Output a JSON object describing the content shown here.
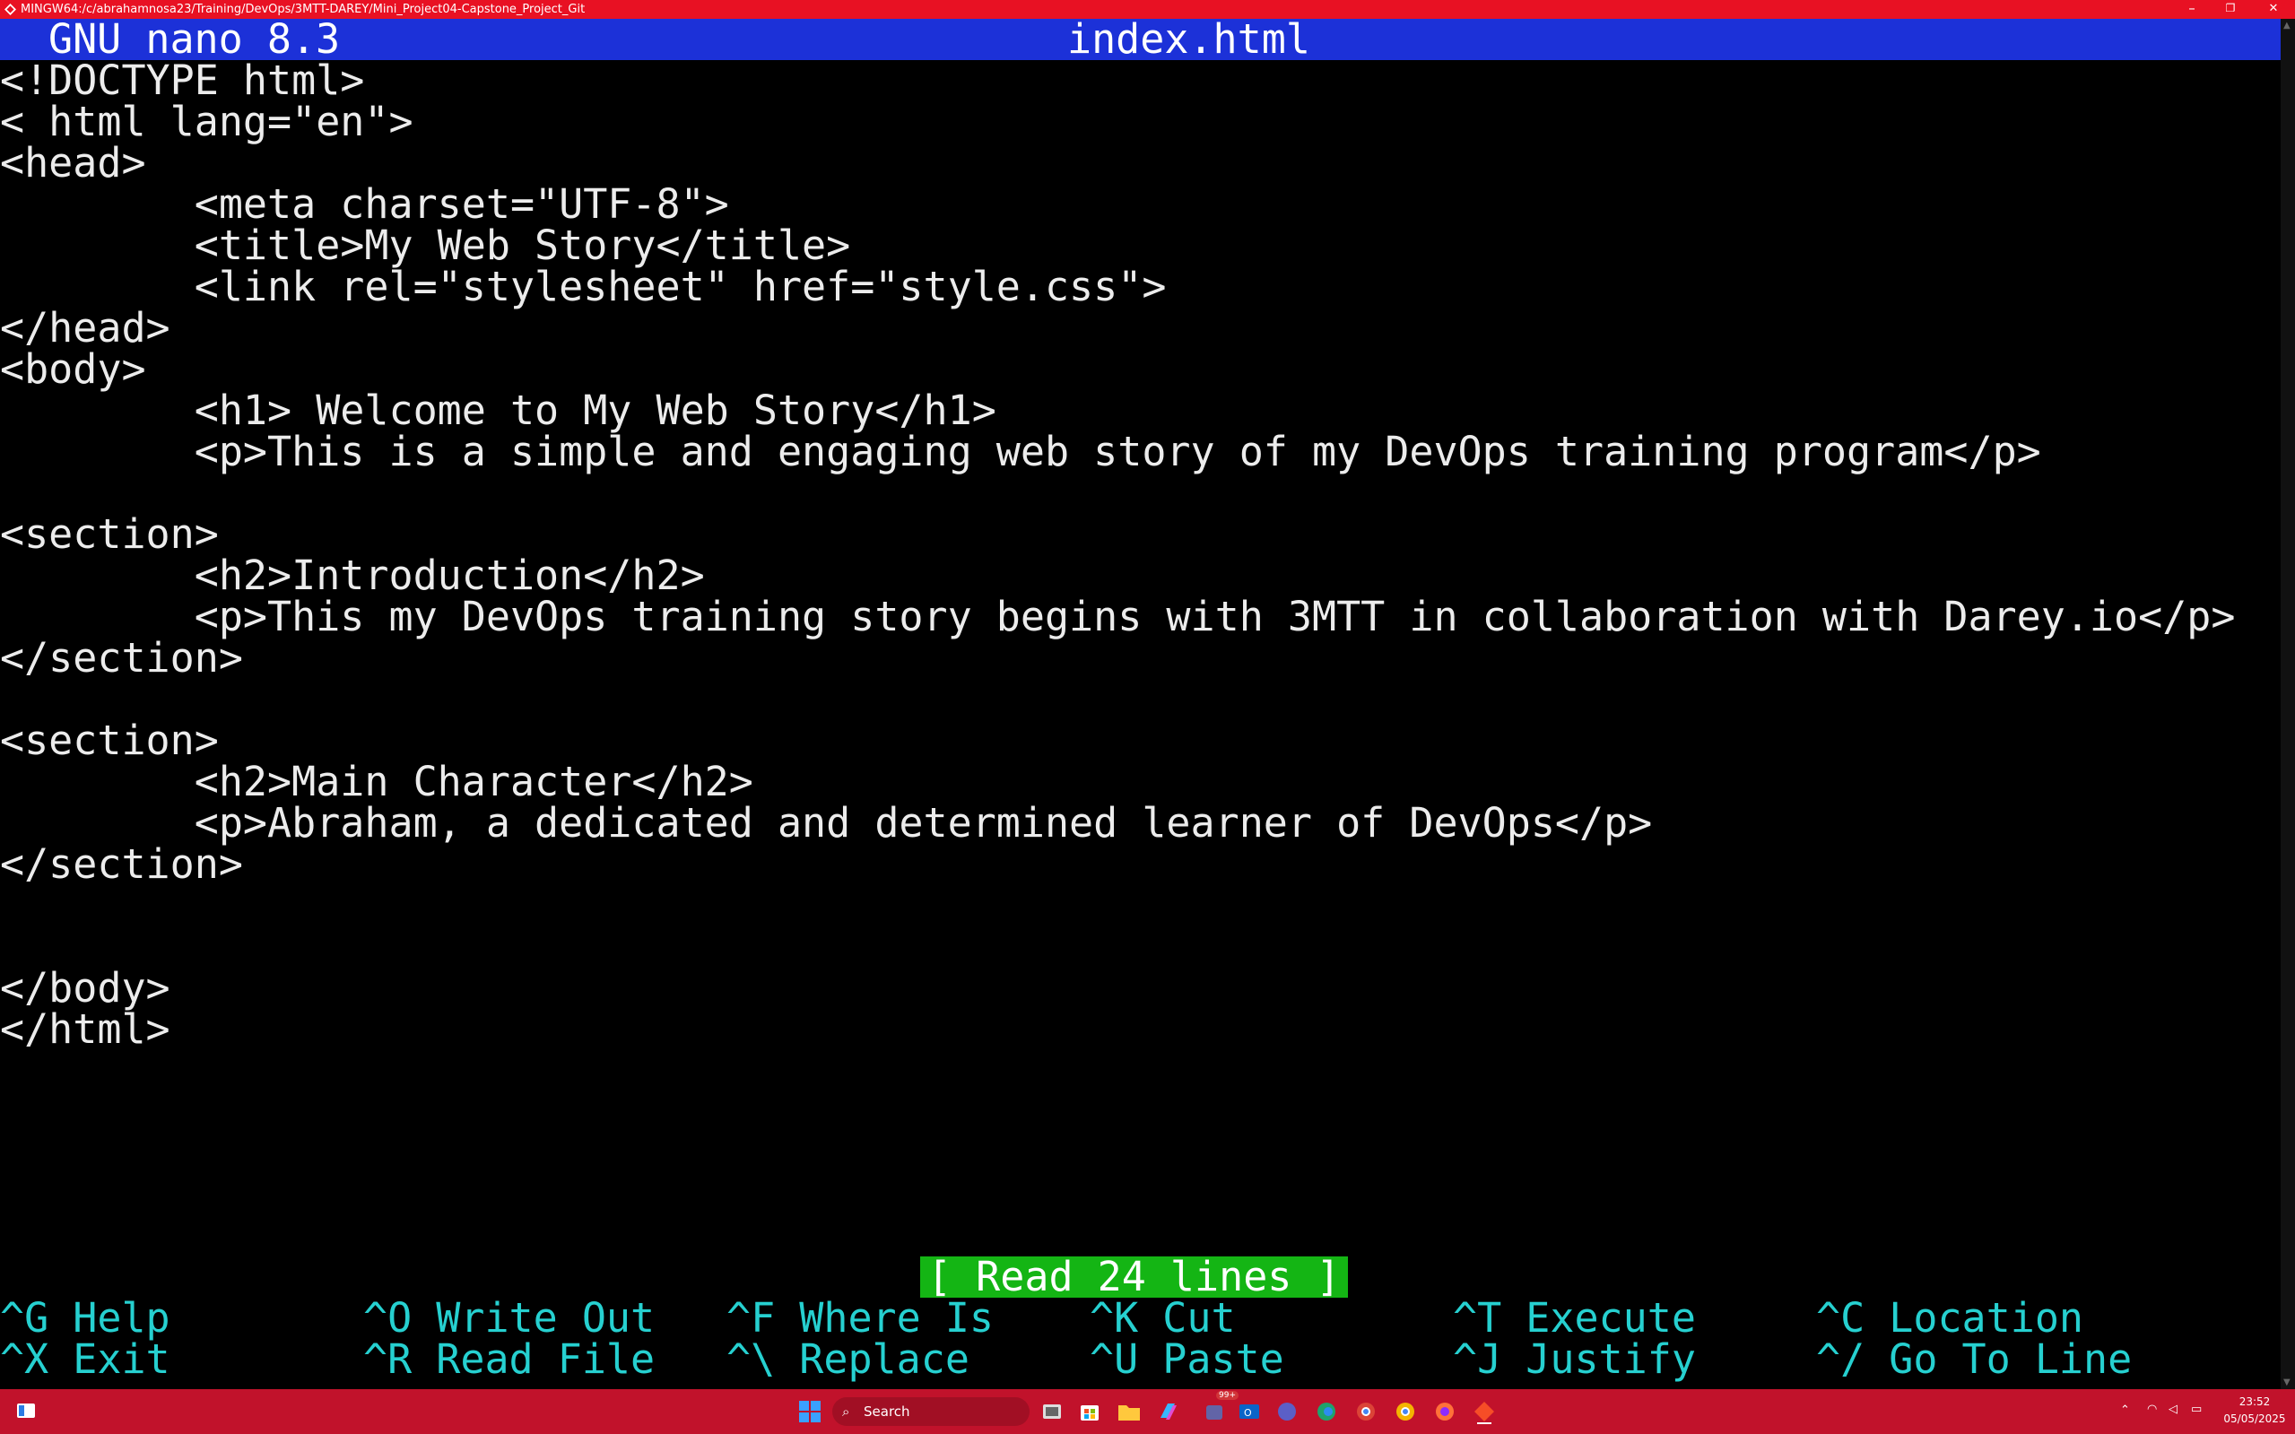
{
  "window": {
    "title": "MINGW64:/c/abrahamnosa23/Training/DevOps/3MTT-DAREY/Mini_Project04-Capstone_Project_Git",
    "controls": {
      "minimize": "–",
      "maximize": "❐",
      "close": "✕"
    }
  },
  "nano": {
    "version": "GNU nano 8.3",
    "filename": "index.html",
    "lines": [
      "<!DOCTYPE html>",
      "< html lang=\"en\">",
      "<head>",
      "        <meta charset=\"UTF-8\">",
      "        <title>My Web Story</title>",
      "        <link rel=\"stylesheet\" href=\"style.css\">",
      "</head>",
      "<body>",
      "        <h1> Welcome to My Web Story</h1>",
      "        <p>This is a simple and engaging web story of my DevOps training program</p>",
      "",
      "<section>",
      "        <h2>Introduction</h2>",
      "        <p>This my DevOps training story begins with 3MTT in collaboration with Darey.io</p>",
      "</section>",
      "",
      "<section>",
      "        <h2>Main Character</h2>",
      "        <p>Abraham, a dedicated and determined learner of DevOps</p>",
      "</section>",
      "",
      "",
      "</body>",
      "</html>"
    ],
    "status": "[ Read 24 lines ]",
    "shortcuts": [
      {
        "key": "^G",
        "label": "Help"
      },
      {
        "key": "^O",
        "label": "Write Out"
      },
      {
        "key": "^F",
        "label": "Where Is"
      },
      {
        "key": "^K",
        "label": "Cut"
      },
      {
        "key": "^T",
        "label": "Execute"
      },
      {
        "key": "^C",
        "label": "Location"
      },
      {
        "key": "^X",
        "label": "Exit"
      },
      {
        "key": "^R",
        "label": "Read File"
      },
      {
        "key": "^\\",
        "label": "Replace"
      },
      {
        "key": "^U",
        "label": "Paste"
      },
      {
        "key": "^J",
        "label": "Justify"
      },
      {
        "key": "^/",
        "label": "Go To Line"
      }
    ]
  },
  "taskbar": {
    "search_placeholder": "Search",
    "badge": "99+",
    "time": "23:52",
    "date": "05/05/2025"
  },
  "colors": {
    "titlebar": "#e81123",
    "nano_header": "#1c31d8",
    "status_bg": "#14b514",
    "shortcut_text": "#26d0d0",
    "taskbar": "#c1122b"
  }
}
